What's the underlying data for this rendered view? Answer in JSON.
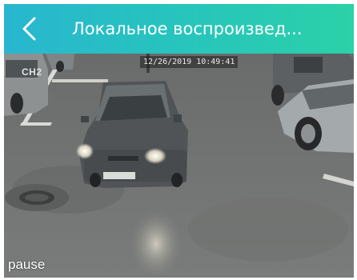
{
  "app_bar": {
    "title": "Локальное воспроизвед...",
    "back_icon": "chevron-left-icon",
    "gradient_colors": [
      "#28b6cf",
      "#2bd1a8"
    ]
  },
  "video": {
    "timestamp": "12/26/2019 10:49:41",
    "channel": "CH2",
    "status": "pause"
  }
}
